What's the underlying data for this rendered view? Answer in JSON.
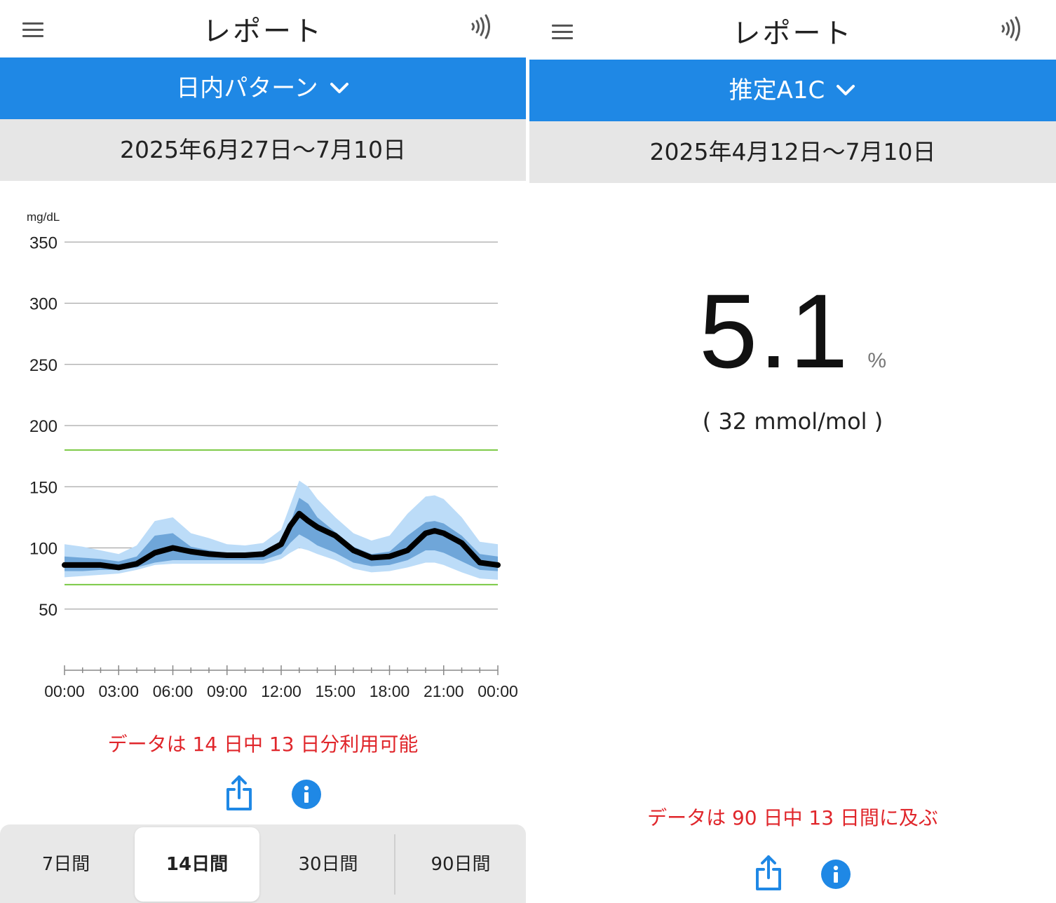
{
  "left": {
    "header": {
      "title": "レポート"
    },
    "report_selector": {
      "label": "日内パターン"
    },
    "date_range": "2025年6月27日〜7月10日",
    "notice": "データは 14 日中 13 日分利用可能",
    "period_tabs": [
      {
        "label": "7日間",
        "active": false
      },
      {
        "label": "14日間",
        "active": true
      },
      {
        "label": "30日間",
        "active": false
      },
      {
        "label": "90日間",
        "active": false
      }
    ]
  },
  "right": {
    "header": {
      "title": "レポート"
    },
    "report_selector": {
      "label": "推定A1C"
    },
    "date_range": "2025年4月12日〜7月10日",
    "a1c_value": "5.1",
    "a1c_unit": "%",
    "mmol_text": "( 32 mmol/mol )",
    "notice": "データは 90 日中 13 日間に及ぶ"
  },
  "colors": {
    "accent_blue": "#1f88e5",
    "notice_red": "#e0262b",
    "target_green": "#7ac943",
    "band_outer": "#bcdcf8",
    "band_inner": "#6fa6d9",
    "median_line": "#000000"
  },
  "icons": [
    "menu-icon",
    "nfc-icon",
    "chevron-down-icon",
    "share-icon",
    "info-icon"
  ],
  "chart_data": {
    "type": "area",
    "ylabel": "mg/dL",
    "ylim": [
      0,
      350
    ],
    "yticks": [
      50,
      100,
      150,
      200,
      250,
      300,
      350
    ],
    "xlim": [
      0,
      24
    ],
    "xtick_labels": [
      "00:00",
      "03:00",
      "06:00",
      "09:00",
      "12:00",
      "15:00",
      "18:00",
      "21:00",
      "00:00"
    ],
    "target_range": [
      70,
      180
    ],
    "grid": true,
    "x": [
      0,
      1,
      2,
      3,
      4,
      5,
      6,
      7,
      8,
      9,
      10,
      11,
      12,
      12.5,
      13,
      13.5,
      14,
      15,
      16,
      17,
      18,
      19,
      20,
      20.5,
      21,
      22,
      23,
      24
    ],
    "series": [
      {
        "values": [
          103,
          101,
          98,
          95,
          102,
          122,
          125,
          112,
          108,
          103,
          102,
          104,
          115,
          135,
          155,
          150,
          140,
          125,
          112,
          106,
          110,
          128,
          142,
          143,
          140,
          125,
          105,
          103
        ]
      },
      {
        "values": [
          93,
          92,
          91,
          89,
          93,
          110,
          112,
          101,
          98,
          96,
          95,
          96,
          103,
          120,
          141,
          136,
          125,
          113,
          101,
          95,
          97,
          110,
          121,
          122,
          120,
          110,
          95,
          93
        ]
      },
      {
        "values": [
          86,
          86,
          86,
          84,
          87,
          96,
          100,
          97,
          95,
          94,
          94,
          95,
          103,
          118,
          128,
          122,
          117,
          110,
          98,
          92,
          93,
          98,
          112,
          114,
          112,
          104,
          88,
          86
        ]
      },
      {
        "values": [
          81,
          81,
          82,
          82,
          84,
          88,
          90,
          90,
          90,
          90,
          90,
          90,
          95,
          104,
          111,
          107,
          102,
          96,
          88,
          85,
          86,
          90,
          98,
          98,
          96,
          89,
          82,
          81
        ]
      },
      {
        "values": [
          76,
          77,
          78,
          79,
          82,
          86,
          87,
          87,
          87,
          87,
          87,
          87,
          91,
          96,
          100,
          98,
          95,
          90,
          83,
          80,
          81,
          84,
          88,
          88,
          86,
          80,
          75,
          74
        ]
      }
    ]
  }
}
